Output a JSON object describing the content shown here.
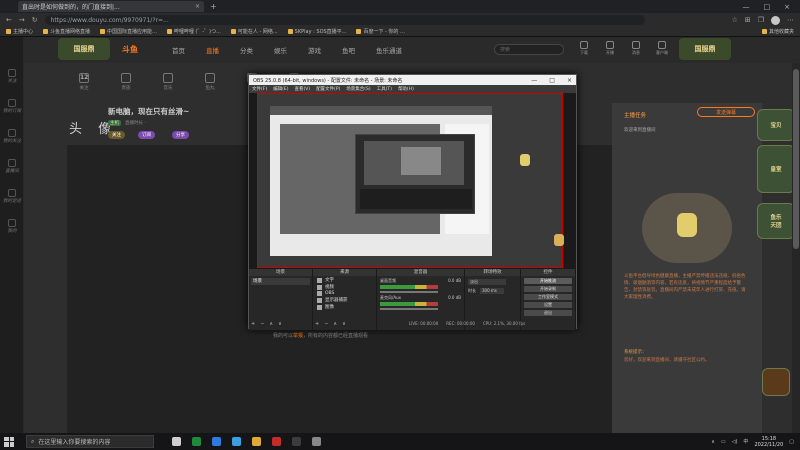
{
  "browser": {
    "tab": {
      "title": "直出时是如何做到的，的门直接到|...",
      "close": "×"
    },
    "new_tab": "+",
    "window_controls": {
      "minimize": "—",
      "maximize": "□",
      "close": "×"
    },
    "nav": {
      "back": "←",
      "forward": "→",
      "reload": "↻"
    },
    "url": "https://www.douyu.com/9970971/?r=...",
    "bookmarks": [
      "主播中心",
      "斗鱼直播网络直播",
      "中国国际直播应用能...",
      "哔哩哔哩 (゜-゜)つ...",
      "可能在人 - 网络...",
      "SKPlay : SOS直播平...",
      "百度一下 - 你的 ...",
      "其他收藏夹"
    ]
  },
  "left_sidebar": [
    "关注",
    "我的订阅",
    "我的关注",
    "直播间",
    "我的足迹",
    "我的"
  ],
  "douyu": {
    "brand_left": "国服鼎",
    "logo": "斗鱼",
    "nav": [
      "首页",
      "直播",
      "分类",
      "娱乐",
      "游戏",
      "鱼吧",
      "鱼乐通道"
    ],
    "nav_active": "直播",
    "search_placeholder": "搜索",
    "header_icons": [
      "下载",
      "开播",
      "消息",
      "客户端",
      "关注",
      "历史"
    ],
    "brand_right": "国服鼎",
    "icon_row": [
      {
        "top": "12",
        "label": "关注"
      },
      {
        "top": "",
        "label": "贵族"
      },
      {
        "top": "",
        "label": "音乐"
      },
      {
        "top": "",
        "label": "鱼丸"
      },
      {
        "top": "",
        "label": "游戏"
      },
      {
        "top": "",
        "label": "鱼乐"
      }
    ],
    "streamer_name": "头 像",
    "stream_title": "新电脑，现在只有丝滑~",
    "tag": "主机",
    "meta": "直播时长 ·",
    "pills": [
      "关注",
      "订阅",
      "分享"
    ],
    "player_caption_prefix": "我的可以",
    "player_caption_link": "举报",
    "player_caption_suffix": "，所有的内容都已经直播观看",
    "right_panel": {
      "header": "主播任务",
      "sub": "欢迎来到直播间",
      "body": "斗鱼平台倡导绿色健康直播，主播严禁传播违法违规、低俗色情、吸烟酗酒等内容，若有违反，将视情节严重程度给予警告、封禁等处罚。直播间内严禁未成年人进行打赏、充值。请大家理性消费。",
      "notice_title": "系统提示：",
      "notice": "您好，欢迎来到直播间，请遵守社区公约。",
      "btn": "发送弹幕"
    },
    "badges": [
      "宝贝",
      "皇室",
      "鱼乐\n天团"
    ]
  },
  "obs": {
    "title": "OBS 25.0.8 (64-bit, windows) - 配置文件: 未命名 - 场景: 未命名",
    "menu": [
      "文件(F)",
      "编辑(E)",
      "查看(V)",
      "配置文件(P)",
      "场景集合(S)",
      "工具(T)",
      "帮助(H)"
    ],
    "docks": {
      "scenes": {
        "title": "场景",
        "items": [
          "场景"
        ]
      },
      "sources": {
        "title": "来源",
        "items": [
          "文字",
          "视频",
          "OBS",
          "显示器捕获",
          "图像"
        ]
      },
      "mixer": {
        "title": "混音器",
        "channels": [
          {
            "name": "桌面音频",
            "level": "0.0 dB"
          },
          {
            "name": "麦克风/Aux",
            "level": "0.0 dB"
          }
        ]
      },
      "transitions": {
        "title": "转场特效",
        "type": "淡出",
        "duration_label": "时长",
        "duration": "300 ms"
      },
      "controls": {
        "title": "控件",
        "buttons": [
          "开始推流",
          "开始录制",
          "工作室模式",
          "设置",
          "退出"
        ]
      }
    },
    "status": {
      "live": "LIVE: 00:00:00",
      "rec": "REC: 00:00:00",
      "cpu": "CPU: 2.1%, 30.00 fps"
    },
    "dock_tools": [
      "+",
      "−",
      "∧",
      "∨"
    ]
  },
  "taskbar": {
    "search": "在这里输入你要搜索的内容",
    "time": "15:18",
    "date": "2022/11/20",
    "lang": "中",
    "app_colors": [
      "#cfcfcf",
      "#1f8a3c",
      "#2d7be0",
      "#3aa0e0",
      "#e0a73a",
      "#c42b2b",
      "#3c3c3c",
      "#888888"
    ]
  }
}
